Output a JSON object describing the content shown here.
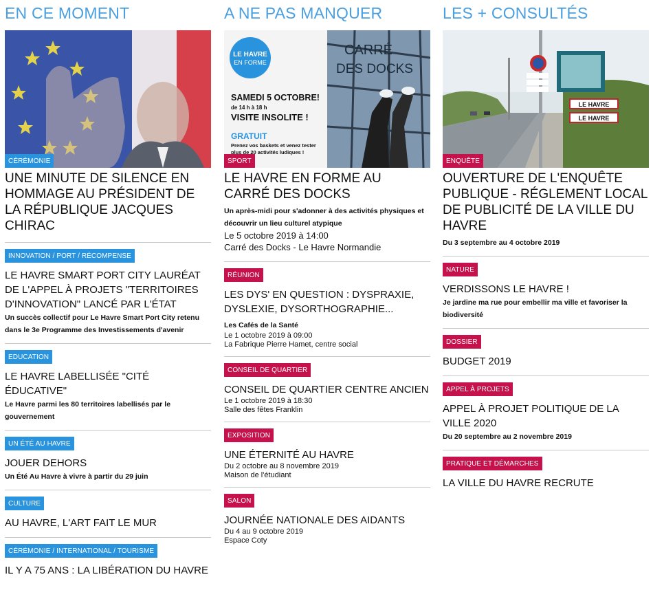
{
  "columns": {
    "en_ce_moment": {
      "heading": "EN CE MOMENT",
      "hero": {
        "tag": "CÉRÉMONIE",
        "title": "UNE MINUTE DE SILENCE EN HOMMAGE AU PRÉSIDENT DE LA RÉPUBLIQUE JACQUES CHIRAC"
      },
      "items": [
        {
          "tag": "INNOVATION / PORT / RÉCOMPENSE",
          "title": "LE HAVRE SMART PORT CITY LAURÉAT DE L'APPEL À PROJETS \"TERRITOIRES D'INNOVATION\" LANCÉ PAR L'ÉTAT",
          "desc": "Un succès collectif pour Le Havre Smart Port City retenu dans le 3e Programme des Investissements d'avenir"
        },
        {
          "tag": "EDUCATION",
          "title": "LE HAVRE LABELLISÉE \"CITÉ ÉDUCATIVE\"",
          "desc": "Le Havre parmi les 80 territoires labellisés par le gouvernement"
        },
        {
          "tag": "UN ÉTÉ AU HAVRE",
          "title": "JOUER DEHORS",
          "desc": "Un Été Au Havre à vivre à partir du 29 juin"
        },
        {
          "tag": "CULTURE",
          "title": "AU HAVRE, L'ART FAIT LE MUR",
          "desc": ""
        },
        {
          "tag": "CÉRÉMONIE / INTERNATIONAL / TOURISME",
          "title": "IL Y A 75 ANS : LA LIBÉRATION DU HAVRE",
          "desc": ""
        }
      ]
    },
    "a_ne_pas_manquer": {
      "heading": "A NE PAS MANQUER",
      "hero": {
        "tag": "SPORT",
        "title": "LE HAVRE EN FORME AU CARRÉ DES DOCKS",
        "desc": "Un après-midi pour s'adonner à des activités physiques et découvrir un lieu culturel atypique",
        "date": "Le 5 octobre 2019 à 14:00",
        "place": "Carré des Docks - Le Havre Normandie",
        "image_text": {
          "logo_line1": "LE HAVRE",
          "logo_line2": "EN FORME",
          "date": "SAMEDI 5 OCTOBRE!",
          "hours": "de 14 h à 18 h",
          "visit": "VISITE INSOLITE !",
          "free": "GRATUIT",
          "free_sub1": "Prenez vos baskets et venez tester",
          "free_sub2": "plus de 20 activités ludiques !",
          "sign1": "CARRÉ",
          "sign2": "DES DOCKS"
        }
      },
      "items": [
        {
          "tag": "Réunion",
          "title": "LES DYS' EN QUESTION : DYSPRAXIE, DYSLEXIE, DYSORTHOGRAPHIE...",
          "sub": "Les Cafés de la Santé",
          "date": "Le 1 octobre 2019 à 09:00",
          "place": "La Fabrique Pierre Hamet, centre social"
        },
        {
          "tag": "CONSEIL DE QUARTIER",
          "title": "CONSEIL DE QUARTIER CENTRE ANCIEN",
          "sub": "",
          "date": "Le 1 octobre 2019 à 18:30",
          "place": "Salle des fêtes Franklin"
        },
        {
          "tag": "Exposition",
          "title": "UNE ÉTERNITÉ AU HAVRE",
          "sub": "",
          "date": "Du 2 octobre au 8 novembre 2019",
          "place": "Maison de l'étudiant"
        },
        {
          "tag": "Salon",
          "title": "JOURNÉE NATIONALE DES AIDANTS",
          "sub": "",
          "date": "Du 4 au 9 octobre 2019",
          "place": "Espace Coty"
        }
      ]
    },
    "les_plus_consultes": {
      "heading": "LES + CONSULTÉS",
      "hero": {
        "tag": "ENQUÊTE",
        "title": "OUVERTURE DE L'ENQUÊTE PUBLIQUE - RÉGLEMENT LOCAL DE PUBLICITÉ DE LA VILLE DU HAVRE",
        "desc": "Du 3 septembre au 4 octobre 2019",
        "image_text": {
          "sign": "LE HAVRE",
          "sign2": "LE HAVRE"
        }
      },
      "items": [
        {
          "tag": "NATURE",
          "title": "VERDISSONS LE HAVRE !",
          "desc": "Je jardine ma rue pour embellir ma ville et favoriser la biodiversité"
        },
        {
          "tag": "DOSSIER",
          "title": "BUDGET 2019",
          "desc": ""
        },
        {
          "tag": "APPEL À PROJETS",
          "title": "APPEL À PROJET POLITIQUE DE LA VILLE 2020",
          "desc": "Du 20 septembre au 2 novembre 2019"
        },
        {
          "tag": "PRATIQUE ET DÉMARCHES",
          "title": "LA VILLE DU HAVRE RECRUTE",
          "desc": ""
        }
      ]
    }
  },
  "colors": {
    "heading": "#4a9fe0",
    "tag_blue": "#2a93de",
    "tag_red": "#c5124c"
  }
}
